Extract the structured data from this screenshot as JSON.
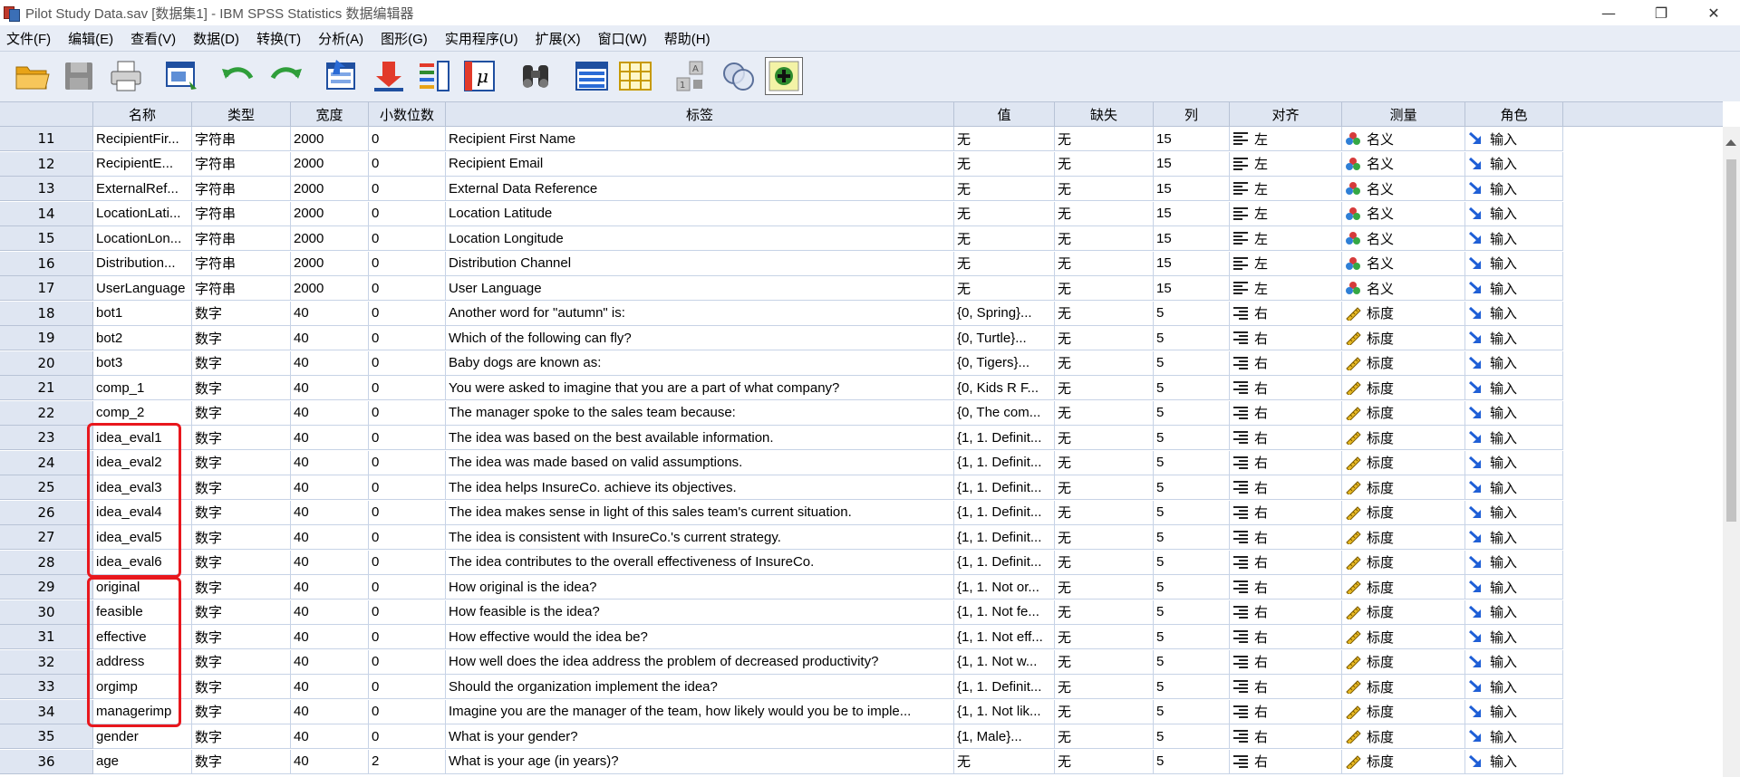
{
  "window": {
    "title": "Pilot Study Data.sav [数据集1] - IBM SPSS Statistics 数据编辑器",
    "minimize_glyph": "—",
    "restore_glyph": "❐",
    "close_glyph": "✕"
  },
  "menu": [
    "文件(F)",
    "编辑(E)",
    "查看(V)",
    "数据(D)",
    "转换(T)",
    "分析(A)",
    "图形(G)",
    "实用程序(U)",
    "扩展(X)",
    "窗口(W)",
    "帮助(H)"
  ],
  "toolbar_icons": [
    "open-folder-icon",
    "save-disk-icon",
    "print-icon",
    "recall-dialog-icon",
    "undo-icon",
    "redo-icon",
    "goto-case-icon",
    "goto-variable-icon",
    "variables-icon",
    "value-labels-icon",
    "find-icon",
    "insert-cases-icon",
    "insert-variable-icon",
    "split-file-icon",
    "weight-cases-icon",
    "select-cases-icon",
    "use-sets-icon"
  ],
  "columns": [
    "",
    "名称",
    "类型",
    "宽度",
    "小数位数",
    "标签",
    "值",
    "缺失",
    "列",
    "对齐",
    "测量",
    "角色"
  ],
  "rows": [
    {
      "n": "11",
      "name": "RecipientFir...",
      "type": "字符串",
      "width": "2000",
      "dec": "0",
      "label": "Recipient First Name",
      "values": "无",
      "missing": "无",
      "cols": "15",
      "align": "左",
      "measure": "名义",
      "role": "输入"
    },
    {
      "n": "12",
      "name": "RecipientE...",
      "type": "字符串",
      "width": "2000",
      "dec": "0",
      "label": "Recipient Email",
      "values": "无",
      "missing": "无",
      "cols": "15",
      "align": "左",
      "measure": "名义",
      "role": "输入"
    },
    {
      "n": "13",
      "name": "ExternalRef...",
      "type": "字符串",
      "width": "2000",
      "dec": "0",
      "label": "External Data Reference",
      "values": "无",
      "missing": "无",
      "cols": "15",
      "align": "左",
      "measure": "名义",
      "role": "输入"
    },
    {
      "n": "14",
      "name": "LocationLati...",
      "type": "字符串",
      "width": "2000",
      "dec": "0",
      "label": "Location Latitude",
      "values": "无",
      "missing": "无",
      "cols": "15",
      "align": "左",
      "measure": "名义",
      "role": "输入"
    },
    {
      "n": "15",
      "name": "LocationLon...",
      "type": "字符串",
      "width": "2000",
      "dec": "0",
      "label": "Location Longitude",
      "values": "无",
      "missing": "无",
      "cols": "15",
      "align": "左",
      "measure": "名义",
      "role": "输入"
    },
    {
      "n": "16",
      "name": "Distribution...",
      "type": "字符串",
      "width": "2000",
      "dec": "0",
      "label": "Distribution Channel",
      "values": "无",
      "missing": "无",
      "cols": "15",
      "align": "左",
      "measure": "名义",
      "role": "输入"
    },
    {
      "n": "17",
      "name": "UserLanguage",
      "type": "字符串",
      "width": "2000",
      "dec": "0",
      "label": "User Language",
      "values": "无",
      "missing": "无",
      "cols": "15",
      "align": "左",
      "measure": "名义",
      "role": "输入"
    },
    {
      "n": "18",
      "name": "bot1",
      "type": "数字",
      "width": "40",
      "dec": "0",
      "label": "Another word for \"autumn\" is:",
      "values": "{0, Spring}...",
      "missing": "无",
      "cols": "5",
      "align": "右",
      "measure": "标度",
      "role": "输入"
    },
    {
      "n": "19",
      "name": "bot2",
      "type": "数字",
      "width": "40",
      "dec": "0",
      "label": "Which of the following can fly?",
      "values": "{0, Turtle}...",
      "missing": "无",
      "cols": "5",
      "align": "右",
      "measure": "标度",
      "role": "输入"
    },
    {
      "n": "20",
      "name": "bot3",
      "type": "数字",
      "width": "40",
      "dec": "0",
      "label": "Baby dogs are known as:",
      "values": "{0, Tigers}...",
      "missing": "无",
      "cols": "5",
      "align": "右",
      "measure": "标度",
      "role": "输入"
    },
    {
      "n": "21",
      "name": "comp_1",
      "type": "数字",
      "width": "40",
      "dec": "0",
      "label": "You were asked to imagine that you are a part of what company?",
      "values": "{0, Kids R F...",
      "missing": "无",
      "cols": "5",
      "align": "右",
      "measure": "标度",
      "role": "输入"
    },
    {
      "n": "22",
      "name": "comp_2",
      "type": "数字",
      "width": "40",
      "dec": "0",
      "label": "The manager spoke to the sales team because:",
      "values": "{0, The com...",
      "missing": "无",
      "cols": "5",
      "align": "右",
      "measure": "标度",
      "role": "输入"
    },
    {
      "n": "23",
      "name": "idea_eval1",
      "type": "数字",
      "width": "40",
      "dec": "0",
      "label": "The idea was based on the best available information.",
      "values": "{1, 1. Definit...",
      "missing": "无",
      "cols": "5",
      "align": "右",
      "measure": "标度",
      "role": "输入"
    },
    {
      "n": "24",
      "name": "idea_eval2",
      "type": "数字",
      "width": "40",
      "dec": "0",
      "label": "The idea was made based on valid assumptions.",
      "values": "{1, 1. Definit...",
      "missing": "无",
      "cols": "5",
      "align": "右",
      "measure": "标度",
      "role": "输入"
    },
    {
      "n": "25",
      "name": "idea_eval3",
      "type": "数字",
      "width": "40",
      "dec": "0",
      "label": "The idea helps InsureCo. achieve its objectives.",
      "values": "{1, 1. Definit...",
      "missing": "无",
      "cols": "5",
      "align": "右",
      "measure": "标度",
      "role": "输入"
    },
    {
      "n": "26",
      "name": "idea_eval4",
      "type": "数字",
      "width": "40",
      "dec": "0",
      "label": "The idea makes sense in light of this sales team's current situation.",
      "values": "{1, 1. Definit...",
      "missing": "无",
      "cols": "5",
      "align": "右",
      "measure": "标度",
      "role": "输入"
    },
    {
      "n": "27",
      "name": "idea_eval5",
      "type": "数字",
      "width": "40",
      "dec": "0",
      "label": "The idea is consistent with InsureCo.'s current strategy.",
      "values": "{1, 1. Definit...",
      "missing": "无",
      "cols": "5",
      "align": "右",
      "measure": "标度",
      "role": "输入"
    },
    {
      "n": "28",
      "name": "idea_eval6",
      "type": "数字",
      "width": "40",
      "dec": "0",
      "label": "The idea contributes to the overall effectiveness of InsureCo.",
      "values": "{1, 1. Definit...",
      "missing": "无",
      "cols": "5",
      "align": "右",
      "measure": "标度",
      "role": "输入"
    },
    {
      "n": "29",
      "name": "original",
      "type": "数字",
      "width": "40",
      "dec": "0",
      "label": "How original is the idea?",
      "values": "{1, 1. Not or...",
      "missing": "无",
      "cols": "5",
      "align": "右",
      "measure": "标度",
      "role": "输入"
    },
    {
      "n": "30",
      "name": "feasible",
      "type": "数字",
      "width": "40",
      "dec": "0",
      "label": "How feasible is the idea?",
      "values": "{1, 1. Not fe...",
      "missing": "无",
      "cols": "5",
      "align": "右",
      "measure": "标度",
      "role": "输入"
    },
    {
      "n": "31",
      "name": "effective",
      "type": "数字",
      "width": "40",
      "dec": "0",
      "label": "How effective would the idea be?",
      "values": "{1, 1. Not eff...",
      "missing": "无",
      "cols": "5",
      "align": "右",
      "measure": "标度",
      "role": "输入"
    },
    {
      "n": "32",
      "name": "address",
      "type": "数字",
      "width": "40",
      "dec": "0",
      "label": "How well does the idea address the problem of decreased productivity?",
      "values": "{1, 1. Not w...",
      "missing": "无",
      "cols": "5",
      "align": "右",
      "measure": "标度",
      "role": "输入"
    },
    {
      "n": "33",
      "name": "orgimp",
      "type": "数字",
      "width": "40",
      "dec": "0",
      "label": "Should the organization implement the idea?",
      "values": "{1, 1. Definit...",
      "missing": "无",
      "cols": "5",
      "align": "右",
      "measure": "标度",
      "role": "输入"
    },
    {
      "n": "34",
      "name": "managerimp",
      "type": "数字",
      "width": "40",
      "dec": "0",
      "label": "Imagine you are the manager of the team, how likely would you be to imple...",
      "values": "{1, 1. Not lik...",
      "missing": "无",
      "cols": "5",
      "align": "右",
      "measure": "标度",
      "role": "输入"
    },
    {
      "n": "35",
      "name": "gender",
      "type": "数字",
      "width": "40",
      "dec": "0",
      "label": "What is your gender?",
      "values": "{1, Male}...",
      "missing": "无",
      "cols": "5",
      "align": "右",
      "measure": "标度",
      "role": "输入"
    },
    {
      "n": "36",
      "name": "age",
      "type": "数字",
      "width": "40",
      "dec": "2",
      "label": "What is your age (in years)?",
      "values": "无",
      "missing": "无",
      "cols": "5",
      "align": "右",
      "measure": "标度",
      "role": "输入"
    }
  ],
  "colors": {
    "header_bg": "#dfe6f2",
    "grid_line": "#c7d3e6",
    "highlight": "#e8171d",
    "menu_bg": "#e8edf6"
  }
}
